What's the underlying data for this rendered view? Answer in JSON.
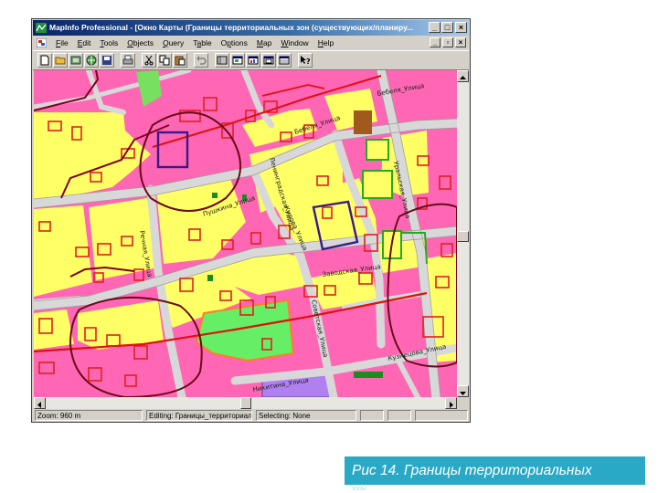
{
  "window": {
    "title": "MapInfo Professional - [Окно Карты (Границы территориальных зон (существующих/планиру..."
  },
  "menu": {
    "items": [
      {
        "prefix": "",
        "key": "F",
        "rest": "ile"
      },
      {
        "prefix": "",
        "key": "E",
        "rest": "dit"
      },
      {
        "prefix": "",
        "key": "T",
        "rest": "ools"
      },
      {
        "prefix": "",
        "key": "O",
        "rest": "bjects"
      },
      {
        "prefix": "",
        "key": "Q",
        "rest": "uery"
      },
      {
        "prefix": "T",
        "key": "a",
        "rest": "ble"
      },
      {
        "prefix": "O",
        "key": "p",
        "rest": "tions"
      },
      {
        "prefix": "",
        "key": "M",
        "rest": "ap"
      },
      {
        "prefix": "",
        "key": "W",
        "rest": "indow"
      },
      {
        "prefix": "",
        "key": "H",
        "rest": "elp"
      }
    ]
  },
  "map": {
    "street_labels": [
      "Бебеля_Улица",
      "Бебеля_Улица",
      "Пушкина_Улица",
      "Ленинградская_Улица",
      "Кирова_Улица",
      "Заводская_Улица",
      "Советская_Улица",
      "Никитина_Улица",
      "Кузнецова_Улица",
      "Уральская_Улица",
      "Речная_Улица"
    ],
    "colors": {
      "residential": "#ffff66",
      "commercial": "#ff66b3",
      "park": "#66ee66",
      "road": "#d8d8d8",
      "building_outline": "#e02020",
      "zone_boundary": "#800020",
      "industrial": "#a070e0"
    }
  },
  "statusbar": {
    "zoom": "Zoom: 960 m",
    "editing": "Editing: Границы_территориаль",
    "selecting": "Selecting: None"
  },
  "caption": {
    "text": "Рис 14. Границы территориальных",
    "tail": "зоны"
  }
}
